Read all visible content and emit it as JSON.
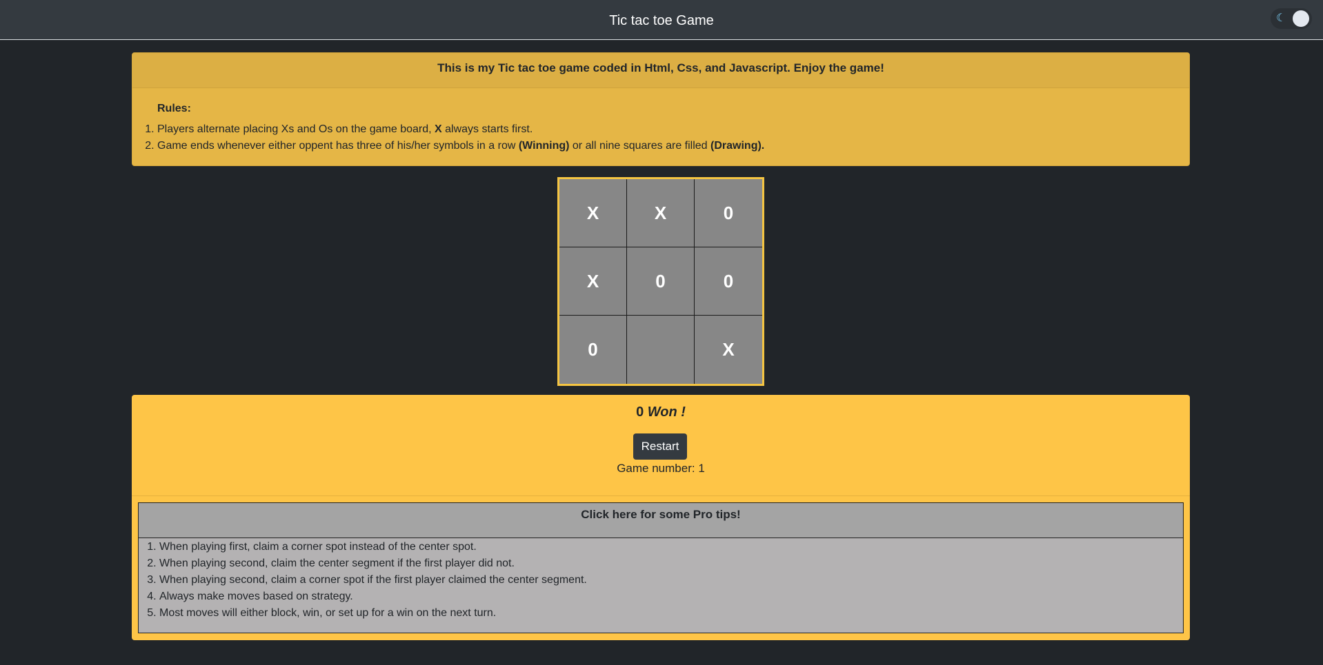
{
  "navbar": {
    "title": "Tic tac toe Game",
    "theme_toggle": {
      "icon": "moon-icon",
      "glyph": "☾"
    }
  },
  "intro": {
    "header": "This is my Tic tac toe game coded in Html, Css, and Javascript. Enjoy the game!",
    "rules_title": "Rules:",
    "rules": [
      {
        "before": "Players alternate placing Xs and Os on the game board, ",
        "bold": "X",
        "after": " always starts first."
      },
      {
        "before": "Game ends whenever either oppent has three of his/her symbols in a row ",
        "bold": "(Winning)",
        "middle": " or all nine squares are filled ",
        "bold2": "(Drawing)."
      }
    ]
  },
  "board": {
    "cells": [
      "X",
      "X",
      "0",
      "X",
      "0",
      "0",
      "0",
      "",
      "X"
    ]
  },
  "result": {
    "winner": "0",
    "won_text": "Won !",
    "restart_label": "Restart",
    "game_number_label": "Game number: ",
    "game_number": "1"
  },
  "tips": {
    "header": "Click here for some Pro tips!",
    "items": [
      "When playing first, claim a corner spot instead of the center spot.",
      "When playing second, claim the center segment if the first player did not.",
      "When playing second, claim a corner spot if the first player claimed the center segment.",
      "Always make moves based on strategy.",
      "Most moves will either block, win, or set up for a win on the next turn."
    ]
  },
  "colors": {
    "background": "#212529",
    "navbar": "#343a40",
    "info_card": "#e5b646",
    "result_card": "#fec547",
    "board_border": "#f5c542",
    "cell": "#878787",
    "tips": "#b4b2b3"
  }
}
